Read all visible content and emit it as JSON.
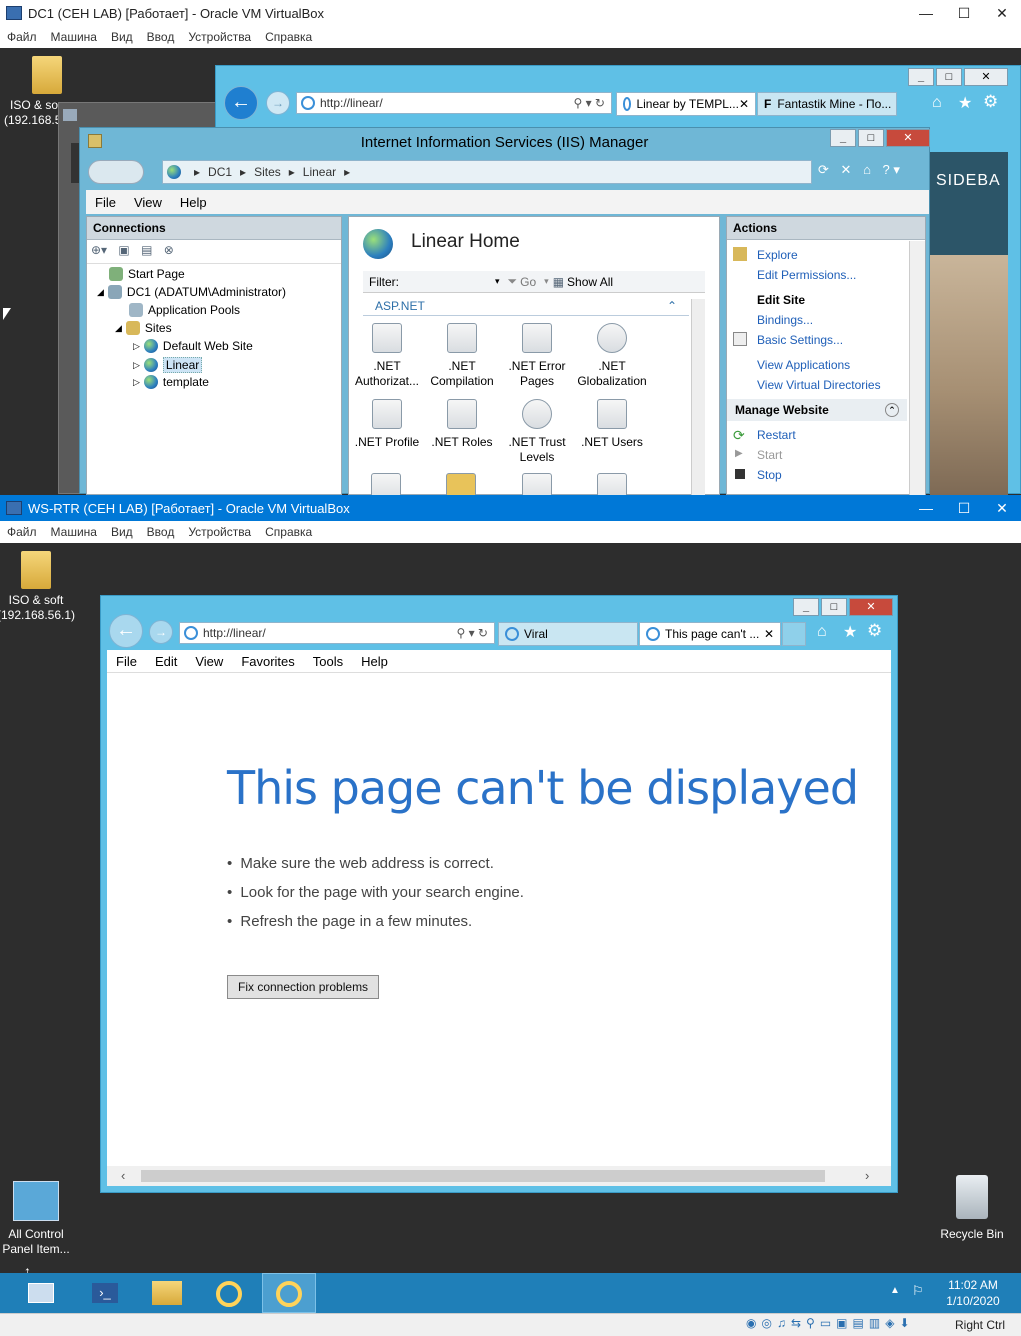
{
  "vm1": {
    "title": "DC1 (CEH LAB) [Работает] - Oracle VM VirtualBox",
    "menu": [
      "Файл",
      "Машина",
      "Вид",
      "Ввод",
      "Устройства",
      "Справка"
    ],
    "desktop_icon_label": "ISO & so",
    "desktop_icon_label2": "(192.168.5"
  },
  "vm1_browser": {
    "address": "http://linear/",
    "tabs": [
      "Linear by TEMPL...",
      "Fantastik Mine - По..."
    ],
    "page_snippet": "SIDEBA"
  },
  "iis": {
    "title": "Internet Information Services (IIS) Manager",
    "breadcrumb": [
      "DC1",
      "Sites",
      "Linear"
    ],
    "menu": [
      "File",
      "View",
      "Help"
    ],
    "connections_header": "Connections",
    "tree": {
      "start_page": "Start Page",
      "server": "DC1 (ADATUM\\Administrator)",
      "app_pools": "Application Pools",
      "sites": "Sites",
      "default_site": "Default Web Site",
      "linear": "Linear",
      "template": "template"
    },
    "home_title": "Linear Home",
    "filter_label": "Filter:",
    "go_label": "Go",
    "show_all_label": "Show All",
    "group_label": "ASP.NET",
    "features": [
      {
        "line1": ".NET",
        "line2": "Authorizat..."
      },
      {
        "line1": ".NET",
        "line2": "Compilation"
      },
      {
        "line1": ".NET Error",
        "line2": "Pages"
      },
      {
        "line1": ".NET",
        "line2": "Globalization"
      },
      {
        "line1": ".NET Profile",
        "line2": ""
      },
      {
        "line1": ".NET Roles",
        "line2": ""
      },
      {
        "line1": ".NET Trust",
        "line2": "Levels"
      },
      {
        "line1": ".NET Users",
        "line2": ""
      }
    ],
    "actions_header": "Actions",
    "actions": {
      "explore": "Explore",
      "edit_permissions": "Edit Permissions...",
      "edit_site": "Edit Site",
      "bindings": "Bindings...",
      "basic_settings": "Basic Settings...",
      "view_applications": "View Applications",
      "view_virtual_dirs": "View Virtual Directories",
      "manage_website": "Manage Website",
      "restart": "Restart",
      "start": "Start",
      "stop": "Stop"
    }
  },
  "vm2": {
    "title": "WS-RTR (CEH LAB) [Работает] - Oracle VM VirtualBox",
    "menu": [
      "Файл",
      "Машина",
      "Вид",
      "Ввод",
      "Устройства",
      "Справка"
    ],
    "desktop_icon_label": "ISO & soft",
    "desktop_icon_label2": "(192.168.56.1)",
    "control_panel_label": "All Control",
    "control_panel_label2": "Panel Item...",
    "recycle_bin_label": "Recycle Bin"
  },
  "browser": {
    "address": "http://linear/",
    "tabs": [
      "Viral",
      "This page can't ..."
    ],
    "menu": [
      "File",
      "Edit",
      "View",
      "Favorites",
      "Tools",
      "Help"
    ],
    "error_title": "This page can't be displayed",
    "bullets": [
      "Make sure the web address is correct.",
      "Look for the page with your search engine.",
      "Refresh the page in a few minutes."
    ],
    "fix_button": "Fix connection problems"
  },
  "taskbar": {
    "time": "11:02 AM",
    "date": "1/10/2020"
  },
  "vbox_status": {
    "host_key": "Right Ctrl"
  },
  "colors": {
    "vbox_active_title": "#0078d7",
    "error_title": "#2a72c8",
    "ie_frame": "#5fc0e6",
    "taskbar": "#1f7fb8",
    "link": "#1f5fb8"
  }
}
